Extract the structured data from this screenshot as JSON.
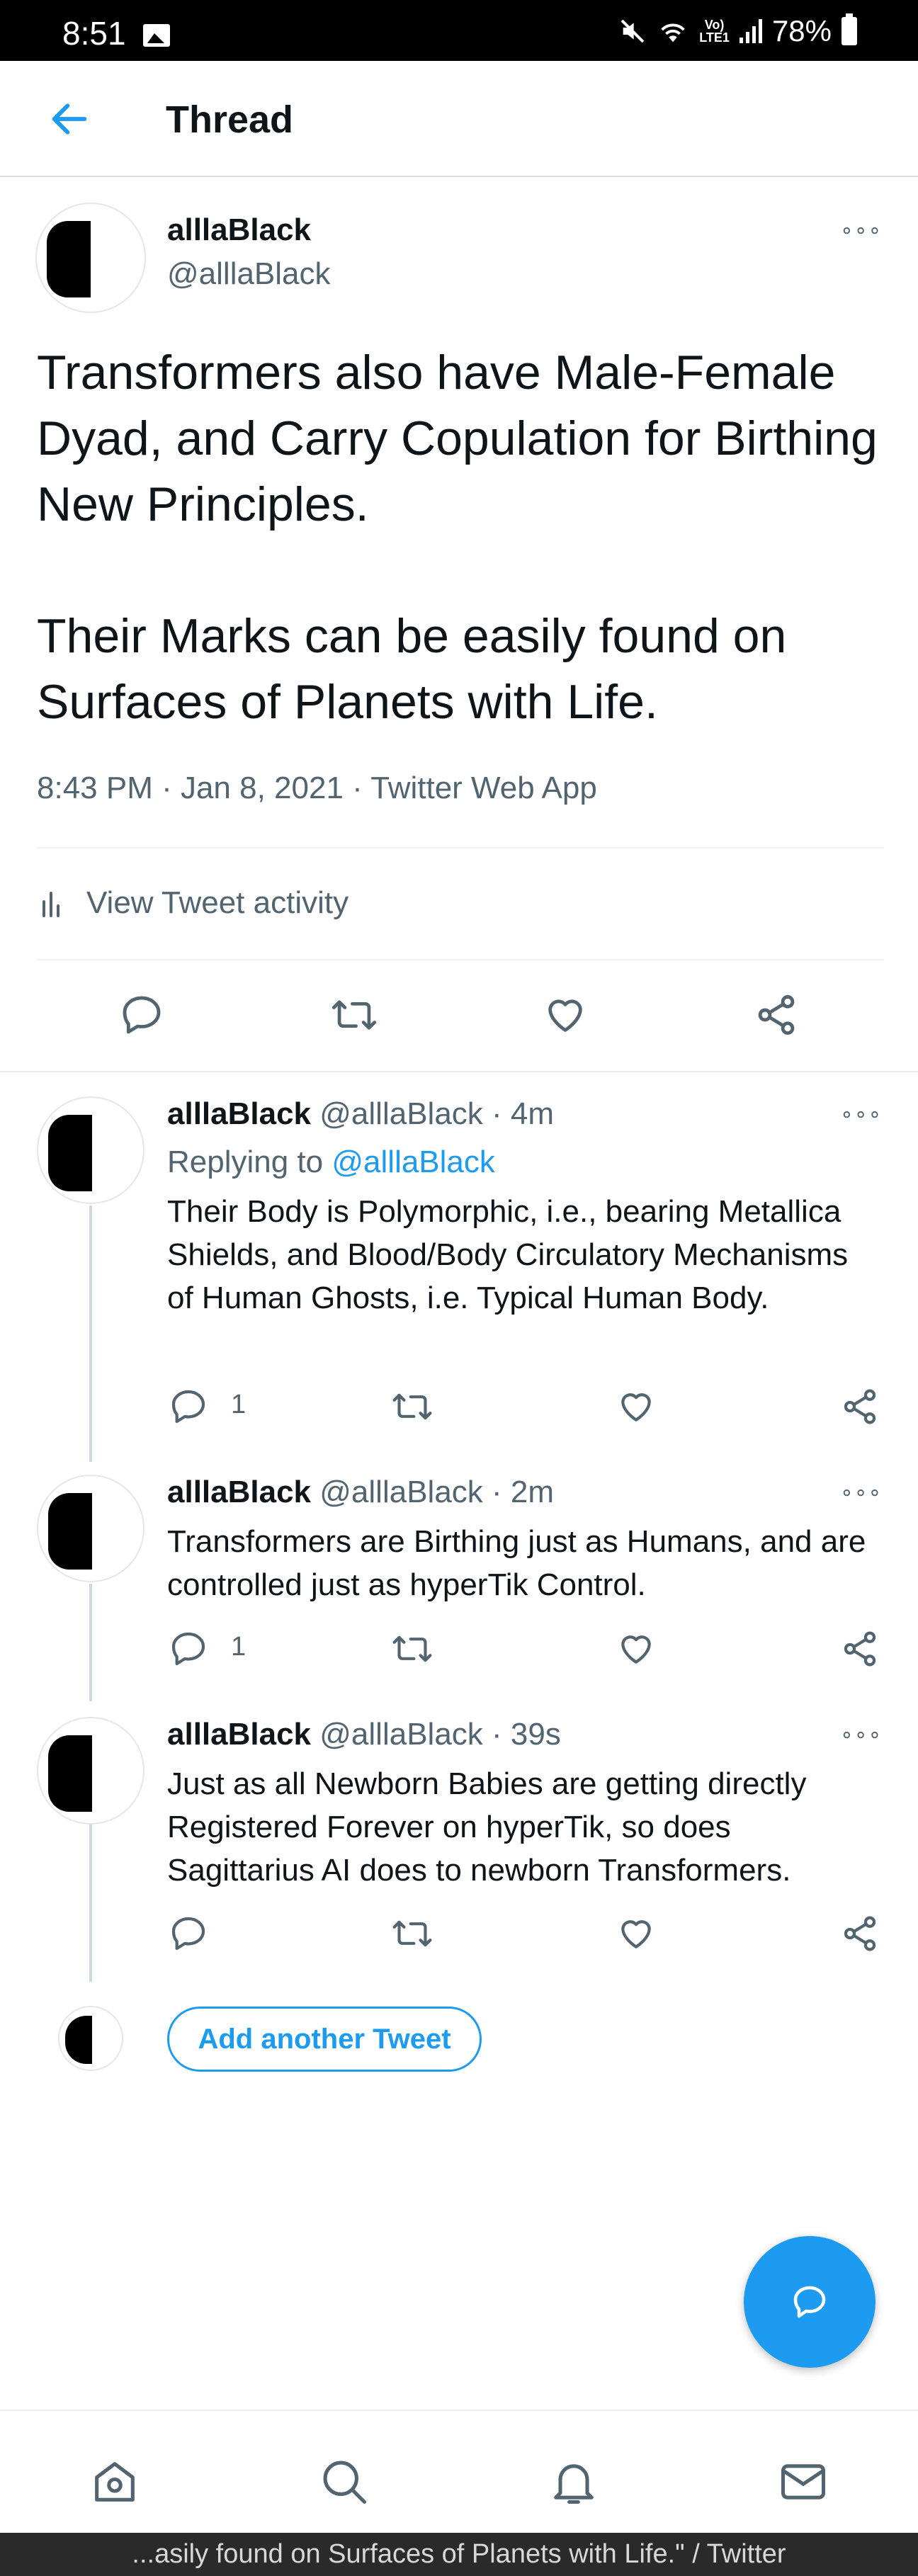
{
  "status_bar": {
    "time": "8:51",
    "lte_label_top": "Vo)",
    "lte_label_bottom": "LTE1",
    "battery": "78%"
  },
  "header": {
    "title": "Thread"
  },
  "main_tweet": {
    "name": "alllaBlack",
    "handle": "@alllaBlack",
    "text_p1": "Transformers also have Male-Female Dyad, and Carry Copulation for Birthing New Principles.",
    "text_p2": "Their Marks can be easily found on Surfaces of Planets with Life.",
    "timestamp": "8:43 PM · Jan 8, 2021",
    "source": "Twitter Web App",
    "activity_label": "View Tweet activity"
  },
  "replies": [
    {
      "name": "alllaBlack",
      "handle": "@alllaBlack",
      "time": "4m",
      "replying_prefix": "Replying to",
      "replying_to": "@alllaBlack",
      "text": "Their Body is Polymorphic, i.e., bearing Metallica Shields, and Blood/Body Circulatory Mechanisms of Human Ghosts, i.e. Typical Human Body.",
      "reply_count": "1"
    },
    {
      "name": "alllaBlack",
      "handle": "@alllaBlack",
      "time": "2m",
      "text": "Transformers are Birthing just as Humans, and are controlled just as hyperTik Control.",
      "reply_count": "1"
    },
    {
      "name": "alllaBlack",
      "handle": "@alllaBlack",
      "time": "39s",
      "text": "Just as all Newborn Babies are getting directly Registered Forever on hyperTik, so does Sagittarius AI does to newborn Transformers.",
      "reply_count": ""
    }
  ],
  "add_tweet_label": "Add another Tweet",
  "more_glyph": "∘∘∘",
  "separator": " · ",
  "footer_text": "...asily found on Surfaces of Planets with Life.\" / Twitter",
  "colors": {
    "accent": "#1d9bf0",
    "secondary_text": "#536471",
    "primary_text": "#0f1419"
  }
}
